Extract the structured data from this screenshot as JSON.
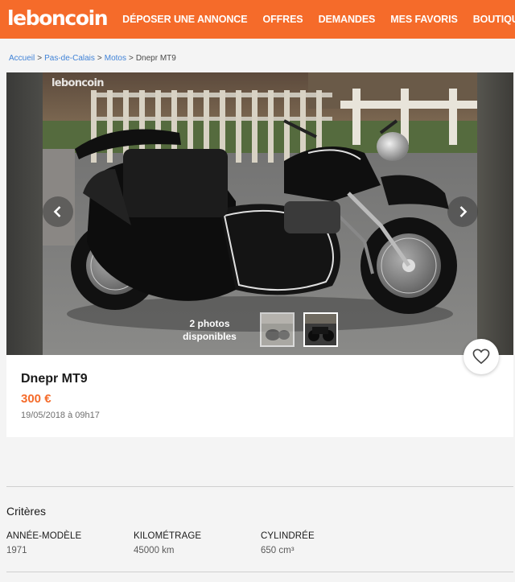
{
  "header": {
    "logo": "leboncoin",
    "nav": [
      "Déposer une annonce",
      "Offres",
      "Demandes",
      "Mes favoris",
      "Boutiques"
    ]
  },
  "breadcrumb": [
    "Accueil",
    "Pas-de-Calais",
    "Motos",
    "Dnepr MT9"
  ],
  "gallery": {
    "watermark": "leboncoin",
    "photo_count_line1": "2 photos",
    "photo_count_line2": "disponibles"
  },
  "listing": {
    "title": "Dnepr MT9",
    "price": "300 €",
    "date": "19/05/2018 à 09h17"
  },
  "criteria": {
    "heading": "Critères",
    "items": [
      {
        "label": "Année-modèle",
        "value": "1971"
      },
      {
        "label": "Kilométrage",
        "value": "45000 km"
      },
      {
        "label": "Cylindrée",
        "value": "650 cm³"
      }
    ]
  },
  "colors": {
    "brand": "#f56b2a",
    "link": "#4183d7"
  }
}
